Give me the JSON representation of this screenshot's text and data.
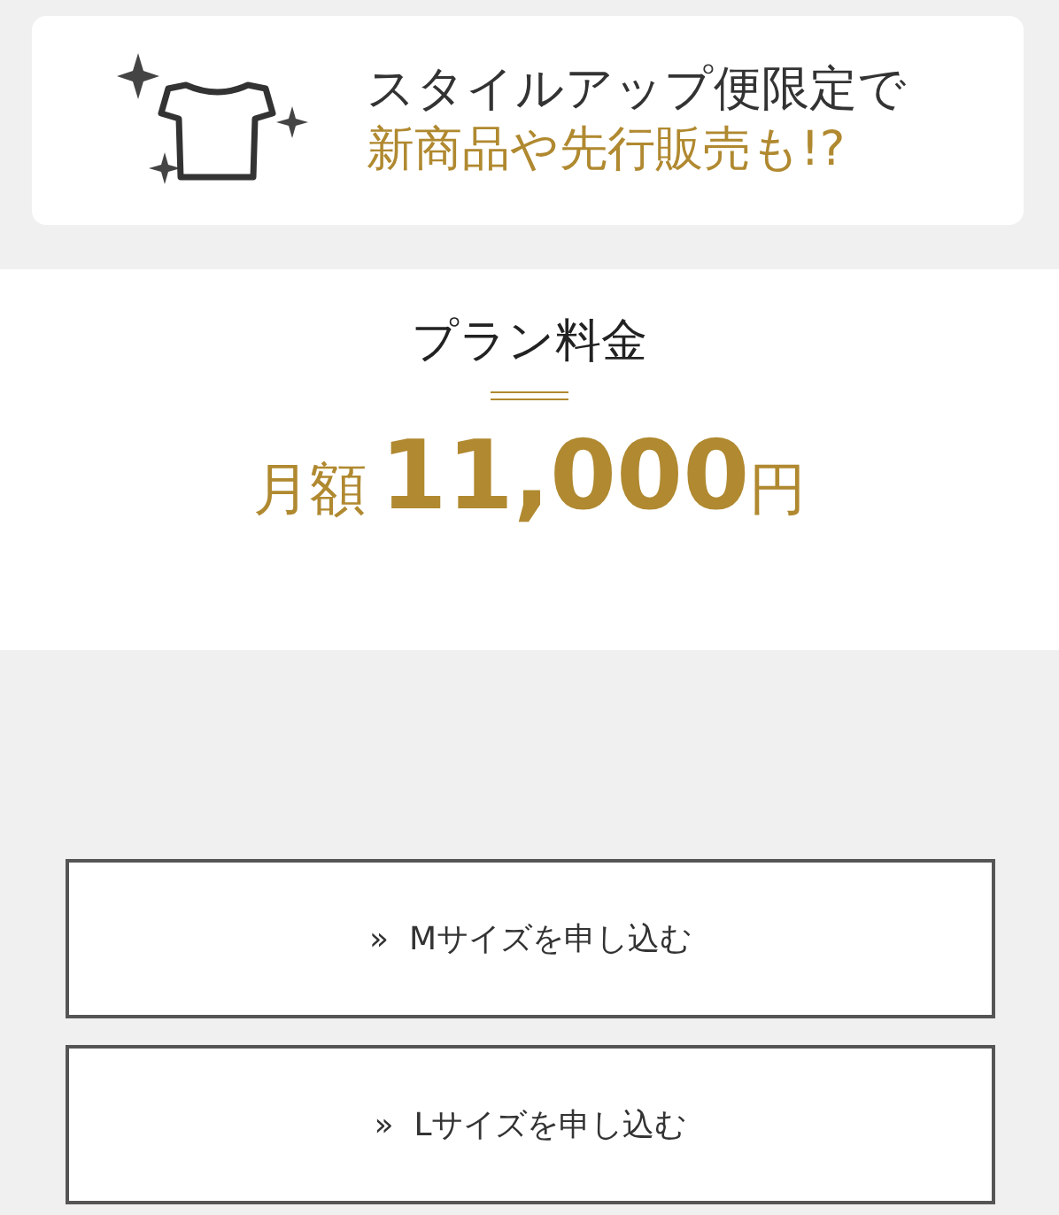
{
  "banner": {
    "line_1": "スタイルアップ便限定で",
    "line_2": "新商品や先行販売も!?"
  },
  "plan": {
    "title": "プラン料金",
    "price_prefix": "月額",
    "price_amount": "11,000",
    "price_suffix": "円"
  },
  "buttons": [
    {
      "arrow": "»",
      "label": "Mサイズを申し込む"
    },
    {
      "arrow": "»",
      "label": "Lサイズを申し込む"
    }
  ]
}
